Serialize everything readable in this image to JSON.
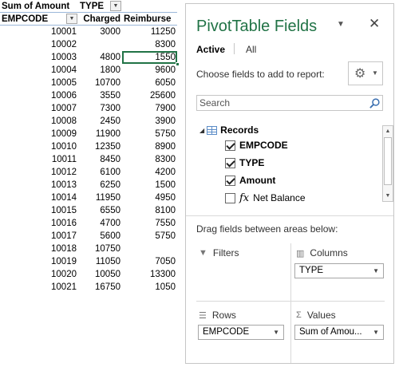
{
  "pivot": {
    "header": {
      "values_field": "Sum of Amount",
      "columns_field": "TYPE",
      "rows_field": "EMPCODE",
      "col_charged": "Charged",
      "col_reimburse": "Reimburse"
    },
    "rows": [
      {
        "empcode": "10001",
        "charged": "3000",
        "reimburse": "11250"
      },
      {
        "empcode": "10002",
        "charged": "",
        "reimburse": "8300"
      },
      {
        "empcode": "10003",
        "charged": "4800",
        "reimburse": "1550"
      },
      {
        "empcode": "10004",
        "charged": "1800",
        "reimburse": "9600"
      },
      {
        "empcode": "10005",
        "charged": "10700",
        "reimburse": "6050"
      },
      {
        "empcode": "10006",
        "charged": "3550",
        "reimburse": "25600"
      },
      {
        "empcode": "10007",
        "charged": "7300",
        "reimburse": "7900"
      },
      {
        "empcode": "10008",
        "charged": "2450",
        "reimburse": "3900"
      },
      {
        "empcode": "10009",
        "charged": "11900",
        "reimburse": "5750"
      },
      {
        "empcode": "10010",
        "charged": "12350",
        "reimburse": "8900"
      },
      {
        "empcode": "10011",
        "charged": "8450",
        "reimburse": "8300"
      },
      {
        "empcode": "10012",
        "charged": "6100",
        "reimburse": "4200"
      },
      {
        "empcode": "10013",
        "charged": "6250",
        "reimburse": "1500"
      },
      {
        "empcode": "10014",
        "charged": "11950",
        "reimburse": "4950"
      },
      {
        "empcode": "10015",
        "charged": "6550",
        "reimburse": "8100"
      },
      {
        "empcode": "10016",
        "charged": "4700",
        "reimburse": "7550"
      },
      {
        "empcode": "10017",
        "charged": "5600",
        "reimburse": "5750"
      },
      {
        "empcode": "10018",
        "charged": "10750",
        "reimburse": ""
      },
      {
        "empcode": "10019",
        "charged": "11050",
        "reimburse": "7050"
      },
      {
        "empcode": "10020",
        "charged": "10050",
        "reimburse": "13300"
      },
      {
        "empcode": "10021",
        "charged": "16750",
        "reimburse": "1050"
      }
    ]
  },
  "pane": {
    "title": "PivotTable Fields",
    "tabs": {
      "active": "Active",
      "all": "All"
    },
    "choose_label": "Choose fields to add to report:",
    "search_placeholder": "Search",
    "table_name": "Records",
    "fields": [
      {
        "label": "EMPCODE",
        "checked": true
      },
      {
        "label": "TYPE",
        "checked": true
      },
      {
        "label": "Amount",
        "checked": true
      },
      {
        "label": "Net Balance",
        "checked": false,
        "calculated": true
      }
    ],
    "drag_label": "Drag fields between areas below:",
    "areas": {
      "filters": {
        "label": "Filters"
      },
      "columns": {
        "label": "Columns",
        "item": "TYPE"
      },
      "rows": {
        "label": "Rows",
        "item": "EMPCODE"
      },
      "values": {
        "label": "Values",
        "item": "Sum of Amou..."
      }
    }
  },
  "colors": {
    "accent": "#217346",
    "selection": "#217346"
  },
  "icons": [
    "dropdown-arrow-icon",
    "close-icon",
    "gear-icon",
    "search-icon",
    "table-icon",
    "checkbox-icon",
    "fx-icon",
    "filter-icon",
    "columns-icon",
    "rows-icon",
    "sigma-icon"
  ]
}
